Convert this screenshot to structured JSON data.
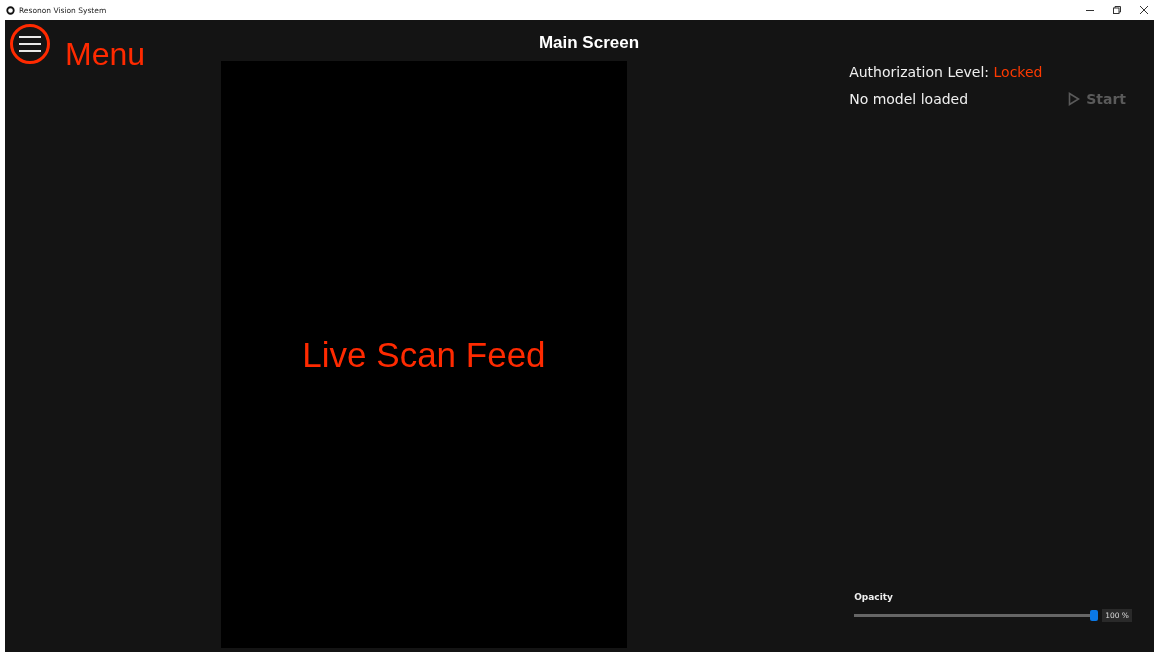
{
  "window": {
    "title": "Resonon Vision System"
  },
  "annotations": {
    "menu": "Menu",
    "feed": "Live Scan Feed"
  },
  "header": {
    "title": "Main Screen"
  },
  "status": {
    "authorization_label": "Authorization Level:",
    "authorization_value": "Locked",
    "model": "No model loaded"
  },
  "start_button": {
    "label": "Start",
    "disabled": true
  },
  "opacity": {
    "label": "Opacity",
    "level": 1.0,
    "reading": "100 %"
  }
}
